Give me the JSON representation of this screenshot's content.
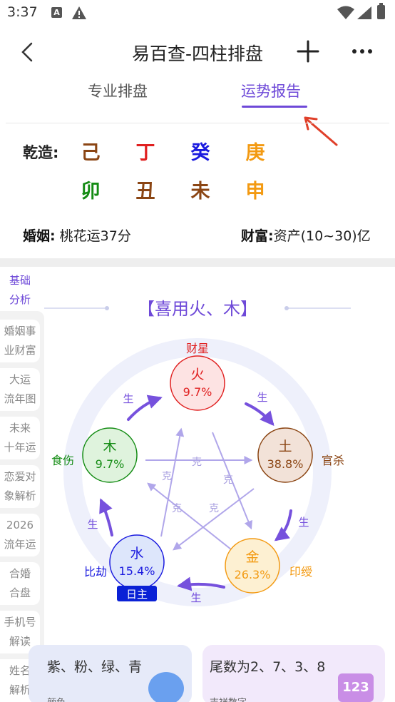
{
  "status_bar": {
    "time": "3:37",
    "a_icon": "A"
  },
  "header": {
    "title": "易百查-四柱排盘"
  },
  "tabs": [
    {
      "label": "专业排盘"
    },
    {
      "label": "运势报告"
    }
  ],
  "bazi": {
    "label": "乾造:",
    "stems": [
      {
        "char": "己",
        "color": "#8b4513"
      },
      {
        "char": "丁",
        "color": "#e02020"
      },
      {
        "char": "癸",
        "color": "#1a1adf"
      },
      {
        "char": "庚",
        "color": "#f39a12"
      }
    ],
    "branches": [
      {
        "char": "卯",
        "color": "#148c14"
      },
      {
        "char": "丑",
        "color": "#8b4513"
      },
      {
        "char": "未",
        "color": "#8b4513"
      },
      {
        "char": "申",
        "color": "#f39a12"
      }
    ]
  },
  "info": {
    "marriage_label": "婚姻:",
    "marriage_value": "桃花运37分",
    "wealth_label": "财富:",
    "wealth_value": "资产(10~30)亿"
  },
  "sidebar": {
    "active": [
      "基础",
      "分析"
    ],
    "items": [
      [
        "婚姻事",
        "业财富"
      ],
      [
        "大运",
        "流年图"
      ],
      [
        "未来",
        "十年运"
      ],
      [
        "恋爱对",
        "象解析"
      ],
      [
        "2026",
        "流年运"
      ],
      [
        "合婚",
        "合盘"
      ],
      [
        "手机号",
        "解读"
      ],
      [
        "姓名",
        "解析"
      ]
    ]
  },
  "wheel": {
    "headline": "【喜用火、木】",
    "elements": [
      {
        "name": "火",
        "percent": "9.7%",
        "role": "财星",
        "color": "#e02020",
        "fill": "#fde3e3"
      },
      {
        "name": "土",
        "percent": "38.8%",
        "role": "官杀",
        "color": "#8b4513",
        "fill": "#f2e2d8"
      },
      {
        "name": "金",
        "percent": "26.3%",
        "role": "印绶",
        "color": "#f39a12",
        "fill": "#fdf0d2"
      },
      {
        "name": "水",
        "percent": "15.4%",
        "role": "比劫",
        "color": "#1a1adf",
        "fill": "#dde6fb"
      },
      {
        "name": "木",
        "percent": "9.7%",
        "role": "食伤",
        "color": "#148c14",
        "fill": "#dff3dd"
      }
    ],
    "day_master": "日主",
    "generate_label": "生",
    "restrain_label": "克"
  },
  "cards": [
    {
      "title": "紫、粉、绿、青",
      "subtitle": "颜色"
    },
    {
      "title": "尾数为2、7、3、8",
      "subtitle": "吉祥数字",
      "badge": "123"
    }
  ]
}
